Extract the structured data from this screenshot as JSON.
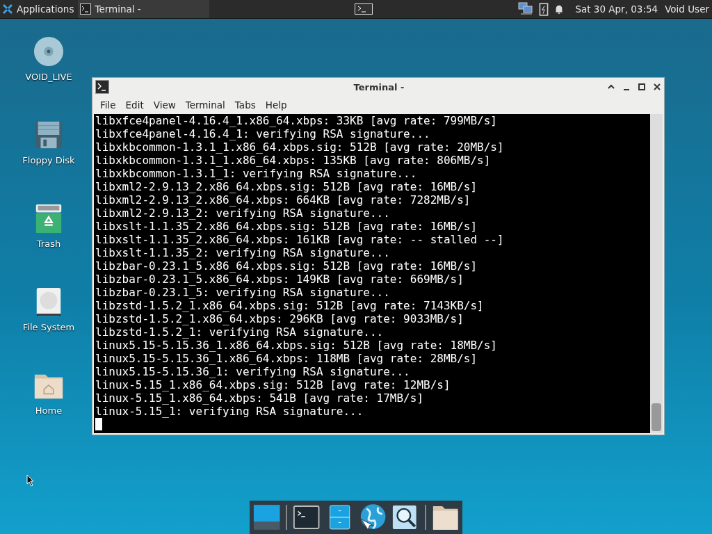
{
  "panel": {
    "applications": "Applications",
    "task": "Terminal -",
    "clock": "Sat 30 Apr, 03:54",
    "user": "Void User"
  },
  "desktop_icons": [
    {
      "kind": "disc",
      "label": "VOID_LIVE"
    },
    {
      "kind": "floppy",
      "label": "Floppy Disk"
    },
    {
      "kind": "trash",
      "label": "Trash"
    },
    {
      "kind": "drive",
      "label": "File System"
    },
    {
      "kind": "home",
      "label": "Home"
    }
  ],
  "window": {
    "title": "Terminal -",
    "menu": [
      "File",
      "Edit",
      "View",
      "Terminal",
      "Tabs",
      "Help"
    ],
    "lines": [
      "libxfce4panel-4.16.4_1.x86_64.xbps: 33KB [avg rate: 799MB/s]",
      "libxfce4panel-4.16.4_1: verifying RSA signature...",
      "libxkbcommon-1.3.1_1.x86_64.xbps.sig: 512B [avg rate: 20MB/s]",
      "libxkbcommon-1.3.1_1.x86_64.xbps: 135KB [avg rate: 806MB/s]",
      "libxkbcommon-1.3.1_1: verifying RSA signature...",
      "libxml2-2.9.13_2.x86_64.xbps.sig: 512B [avg rate: 16MB/s]",
      "libxml2-2.9.13_2.x86_64.xbps: 664KB [avg rate: 7282MB/s]",
      "libxml2-2.9.13_2: verifying RSA signature...",
      "libxslt-1.1.35_2.x86_64.xbps.sig: 512B [avg rate: 16MB/s]",
      "libxslt-1.1.35_2.x86_64.xbps: 161KB [avg rate: -- stalled --]",
      "libxslt-1.1.35_2: verifying RSA signature...",
      "libzbar-0.23.1_5.x86_64.xbps.sig: 512B [avg rate: 16MB/s]",
      "libzbar-0.23.1_5.x86_64.xbps: 149KB [avg rate: 669MB/s]",
      "libzbar-0.23.1_5: verifying RSA signature...",
      "libzstd-1.5.2_1.x86_64.xbps.sig: 512B [avg rate: 7143KB/s]",
      "libzstd-1.5.2_1.x86_64.xbps: 296KB [avg rate: 9033MB/s]",
      "libzstd-1.5.2_1: verifying RSA signature...",
      "linux5.15-5.15.36_1.x86_64.xbps.sig: 512B [avg rate: 18MB/s]",
      "linux5.15-5.15.36_1.x86_64.xbps: 118MB [avg rate: 28MB/s]",
      "linux5.15-5.15.36_1: verifying RSA signature...",
      "linux-5.15_1.x86_64.xbps.sig: 512B [avg rate: 12MB/s]",
      "linux-5.15_1.x86_64.xbps: 541B [avg rate: 17MB/s]",
      "linux-5.15_1: verifying RSA signature..."
    ]
  },
  "dock": [
    {
      "kind": "desktop"
    },
    {
      "kind": "terminal"
    },
    {
      "kind": "files"
    },
    {
      "kind": "web"
    },
    {
      "kind": "search"
    },
    {
      "kind": "folder"
    }
  ]
}
